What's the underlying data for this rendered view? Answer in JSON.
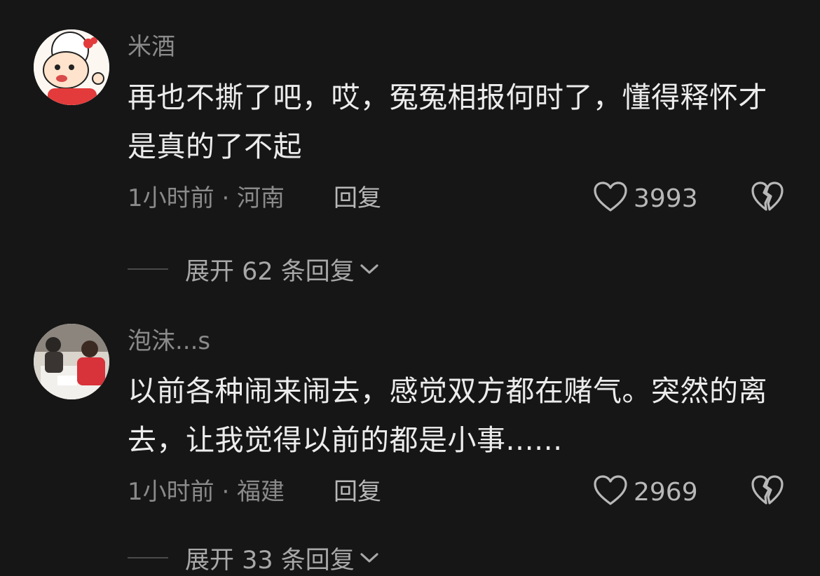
{
  "comments": [
    {
      "username": "米酒",
      "text": "再也不撕了吧，哎，冤冤相报何时了，懂得释怀才是真的了不起",
      "time_location": "1小时前 · 河南",
      "reply_label": "回复",
      "likes": "3993",
      "expand_label": "展开 62 条回复"
    },
    {
      "username": "泡沫...s",
      "text": "以前各种闹来闹去，感觉双方都在赌气。突然的离去，让我觉得以前的都是小事......",
      "time_location": "1小时前 · 福建",
      "reply_label": "回复",
      "likes": "2969",
      "expand_label": "展开 33 条回复"
    }
  ],
  "colors": {
    "background": "#161616",
    "text_primary": "#ececec",
    "text_secondary": "#8a8a8a"
  },
  "icons": {
    "like": "heart-outline-icon",
    "dislike": "broken-heart-icon",
    "expand": "chevron-down-icon"
  }
}
